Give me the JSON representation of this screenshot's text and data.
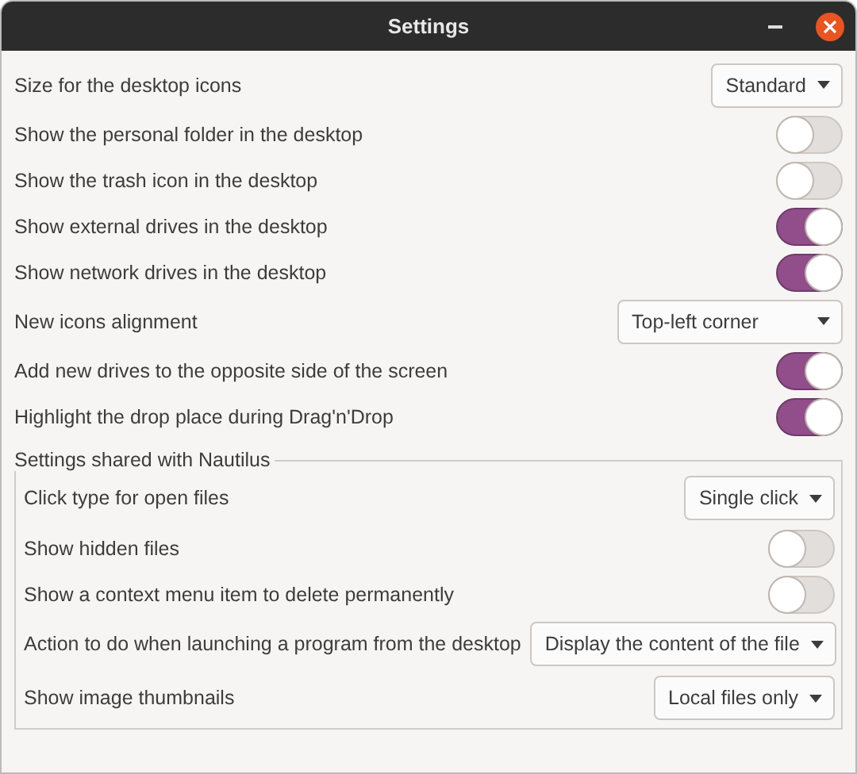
{
  "window": {
    "title": "Settings"
  },
  "rows": [
    {
      "kind": "dropdown",
      "label": "Size for the desktop icons",
      "value": "Standard"
    },
    {
      "kind": "switch",
      "label": "Show the personal folder in the desktop",
      "on": false
    },
    {
      "kind": "switch",
      "label": "Show the trash icon in the desktop",
      "on": false
    },
    {
      "kind": "switch",
      "label": "Show external drives in the desktop",
      "on": true
    },
    {
      "kind": "switch",
      "label": "Show network drives in the desktop",
      "on": true
    },
    {
      "kind": "dropdown",
      "label": "New icons alignment",
      "value": "Top-left corner"
    },
    {
      "kind": "switch",
      "label": "Add new drives to the opposite side of the screen",
      "on": true
    },
    {
      "kind": "switch",
      "label": "Highlight the drop place during Drag'n'Drop",
      "on": true
    }
  ],
  "nautilus": {
    "title": "Settings shared with Nautilus",
    "rows": [
      {
        "kind": "dropdown",
        "label": "Click type for open files",
        "value": "Single click"
      },
      {
        "kind": "switch",
        "label": "Show hidden files",
        "on": false
      },
      {
        "kind": "switch",
        "label": "Show a context menu item to delete permanently",
        "on": false
      },
      {
        "kind": "dropdown",
        "label": "Action to do when launching a program from the desktop",
        "value": "Display the content of the file"
      },
      {
        "kind": "dropdown",
        "label": "Show image thumbnails",
        "value": "Local files only"
      }
    ]
  }
}
